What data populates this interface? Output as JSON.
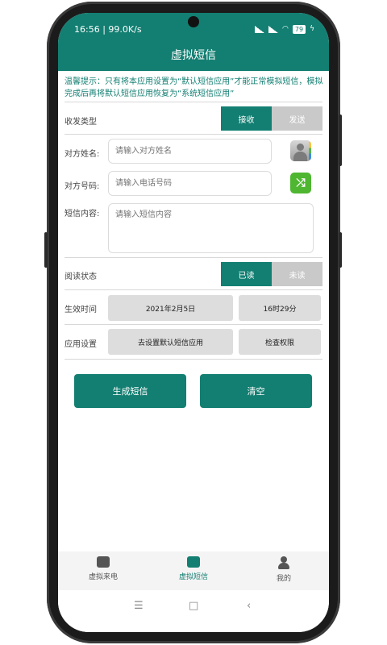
{
  "status": {
    "time": "16:56",
    "speed": "99.0K/s",
    "battery": "79"
  },
  "app": {
    "title": "虚拟短信"
  },
  "notice": "温馨提示：只有将本应用设置为“默认短信应用”才能正常模拟短信，模拟完成后再将默认短信应用恢复为“系统短信应用”",
  "direction": {
    "label": "收发类型",
    "options": [
      "接收",
      "发送"
    ],
    "selected": "接收"
  },
  "name": {
    "label": "对方姓名:",
    "placeholder": "请输入对方姓名"
  },
  "number": {
    "label": "对方号码:",
    "placeholder": "请输入电话号码"
  },
  "content": {
    "label": "短信内容:",
    "placeholder": "请输入短信内容"
  },
  "read_status": {
    "label": "阅读状态",
    "options": [
      "已读",
      "未读"
    ],
    "selected": "已读"
  },
  "effective_time": {
    "label": "生效时间",
    "date": "2021年2月5日",
    "time": "16时29分"
  },
  "app_settings": {
    "label": "应用设置",
    "set_default": "去设置默认短信应用",
    "check_permission": "检查权限"
  },
  "actions": {
    "generate": "生成短信",
    "clear": "清空"
  },
  "bottom_nav": {
    "items": [
      "虚拟来电",
      "虚拟短信",
      "我的"
    ],
    "active": "虚拟短信"
  },
  "colors": {
    "primary": "#137f72",
    "inactive_segment": "#c9c9c9"
  }
}
